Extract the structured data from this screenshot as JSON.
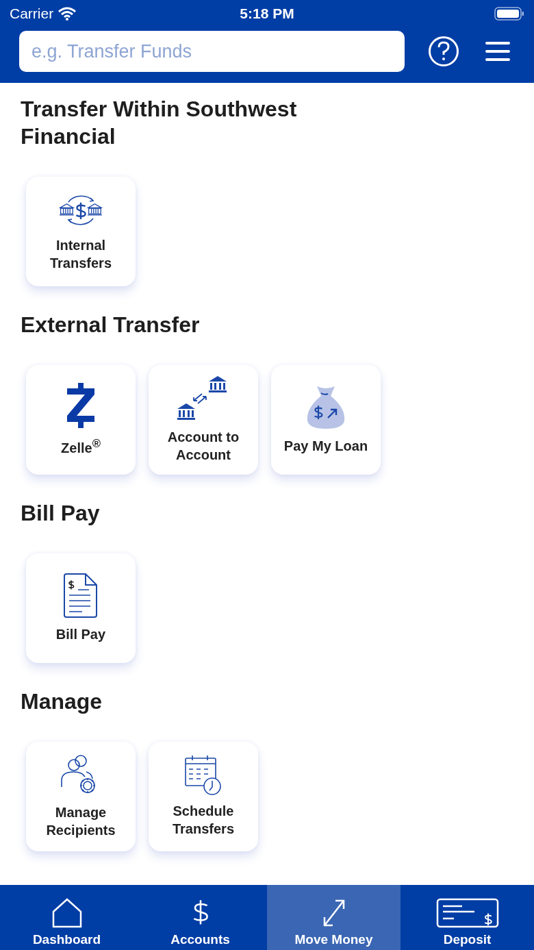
{
  "status_bar": {
    "carrier": "Carrier",
    "time": "5:18 PM"
  },
  "search": {
    "placeholder": "e.g. Transfer Funds"
  },
  "sections": [
    {
      "title": "Transfer Within Southwest Financial",
      "tiles": [
        {
          "kind": "internal",
          "label": "Internal Transfers"
        }
      ]
    },
    {
      "title": "External Transfer",
      "tiles": [
        {
          "kind": "zelle",
          "label": "Zelle$^{®}$"
        },
        {
          "kind": "a2a",
          "label": "Account to Account"
        },
        {
          "kind": "loan",
          "label": "Pay My Loan"
        }
      ]
    },
    {
      "title": "Bill Pay",
      "tiles": [
        {
          "kind": "bill",
          "label": "Bill Pay"
        }
      ]
    },
    {
      "title": "Manage",
      "tiles": [
        {
          "kind": "recipients",
          "label": "Manage Recipients"
        },
        {
          "kind": "schedule",
          "label": "Schedule Transfers"
        }
      ]
    }
  ],
  "tab_bar": [
    {
      "kind": "home",
      "label": "Dashboard",
      "selected": false
    },
    {
      "kind": "dollar",
      "label": "Accounts",
      "selected": false
    },
    {
      "kind": "move",
      "label": "Move Money",
      "selected": true
    },
    {
      "kind": "check",
      "label": "Deposit",
      "selected": false
    }
  ]
}
